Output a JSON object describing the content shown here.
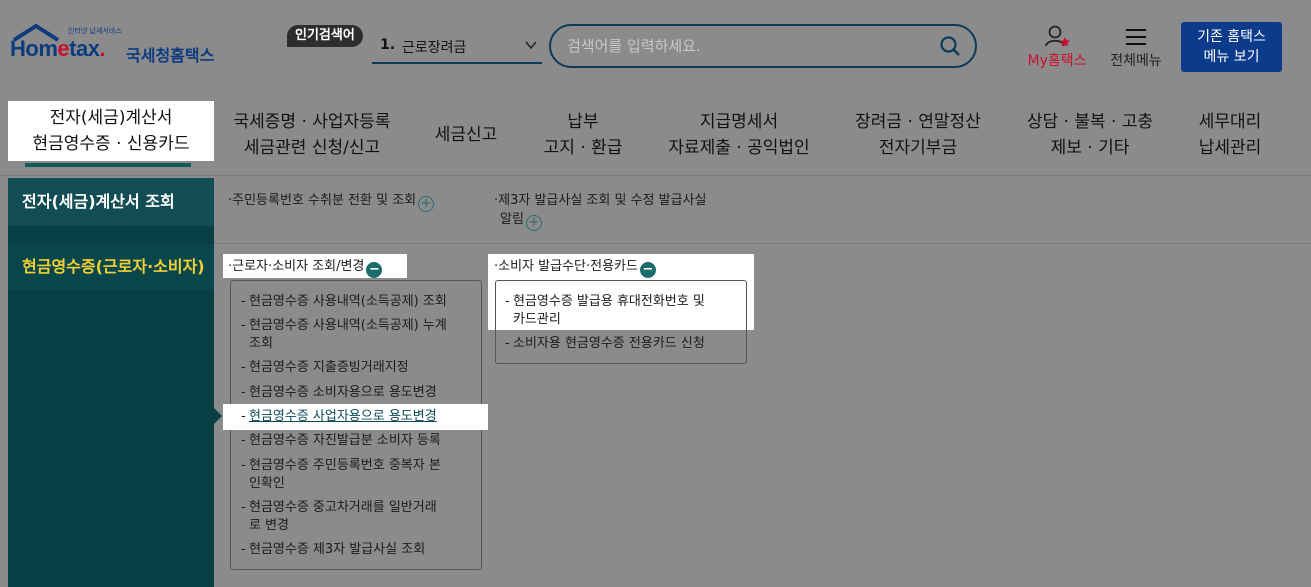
{
  "header": {
    "logo_top": "인터넷 납세서비스",
    "logo_main_a": "Hom",
    "logo_main_b": "e",
    "logo_main_c": "tax",
    "logo_kr": "국세청홈택스",
    "popular_badge": "인기검색어",
    "popular_rank": "1.",
    "popular_term": "근로장려금",
    "search_placeholder": "검색어를 입력하세요.",
    "my_prefix": "My",
    "my_label": "홈택스",
    "all_menu": "전체메뉴",
    "old_line1": "기존 홈택스",
    "old_line2": "메뉴 보기"
  },
  "mainnav": [
    {
      "l1": "전자(세금)계산서",
      "l2": "현금영수증 · 신용카드"
    },
    {
      "l1": "국세증명 · 사업자등록",
      "l2": "세금관련 신청/신고"
    },
    {
      "l1": "세금신고",
      "l2": ""
    },
    {
      "l1": "납부",
      "l2": "고지 · 환급"
    },
    {
      "l1": "지급명세서",
      "l2": "자료제출 · 공익법인"
    },
    {
      "l1": "장려금 · 연말정산",
      "l2": "전자기부금"
    },
    {
      "l1": "상담 · 불복 · 고충",
      "l2": "제보 · 기타"
    },
    {
      "l1": "세무대리",
      "l2": "납세관리"
    }
  ],
  "sidenav": {
    "item1": "전자(세금)계산서 조회",
    "item2": "현금영수증(근로자·소비자)"
  },
  "section1": {
    "link1": "주민등록번호 수취분 전환 및 조회",
    "link2_a": "제3자 발급사실 조회 및 수정 발급사실",
    "link2_b": "알림"
  },
  "section2": {
    "group1_title": "근로자·소비자 조회/변경",
    "group2_title": "소비자 발급수단·전용카드",
    "group1_items": [
      {
        "a": "현금영수증 사용내역(소득공제) 조회",
        "b": ""
      },
      {
        "a": "현금영수증 사용내역(소득공제) 누계",
        "b": "조회"
      },
      {
        "a": "현금영수증 지출증빙거래지정",
        "b": ""
      },
      {
        "a": "현금영수증 소비자용으로 용도변경",
        "b": ""
      },
      {
        "a": "현금영수증 사업자용으로 용도변경",
        "b": ""
      },
      {
        "a": "현금영수증 자진발급분 소비자 등록",
        "b": ""
      },
      {
        "a": "현금영수증 주민등록번호 중복자 본",
        "b": "인확인"
      },
      {
        "a": "현금영수증 중고차거래를 일반거래",
        "b": "로 변경"
      },
      {
        "a": "현금영수증 제3자 발급사실 조회",
        "b": ""
      }
    ],
    "group2_items": [
      {
        "a": "현금영수증 발급용 휴대전화번호 및",
        "b": "카드관리"
      },
      {
        "a": "소비자용 현금영수증 전용카드 신청",
        "b": ""
      }
    ],
    "dash": "-",
    "bullet": "·",
    "plus": "+",
    "minus": "−"
  }
}
